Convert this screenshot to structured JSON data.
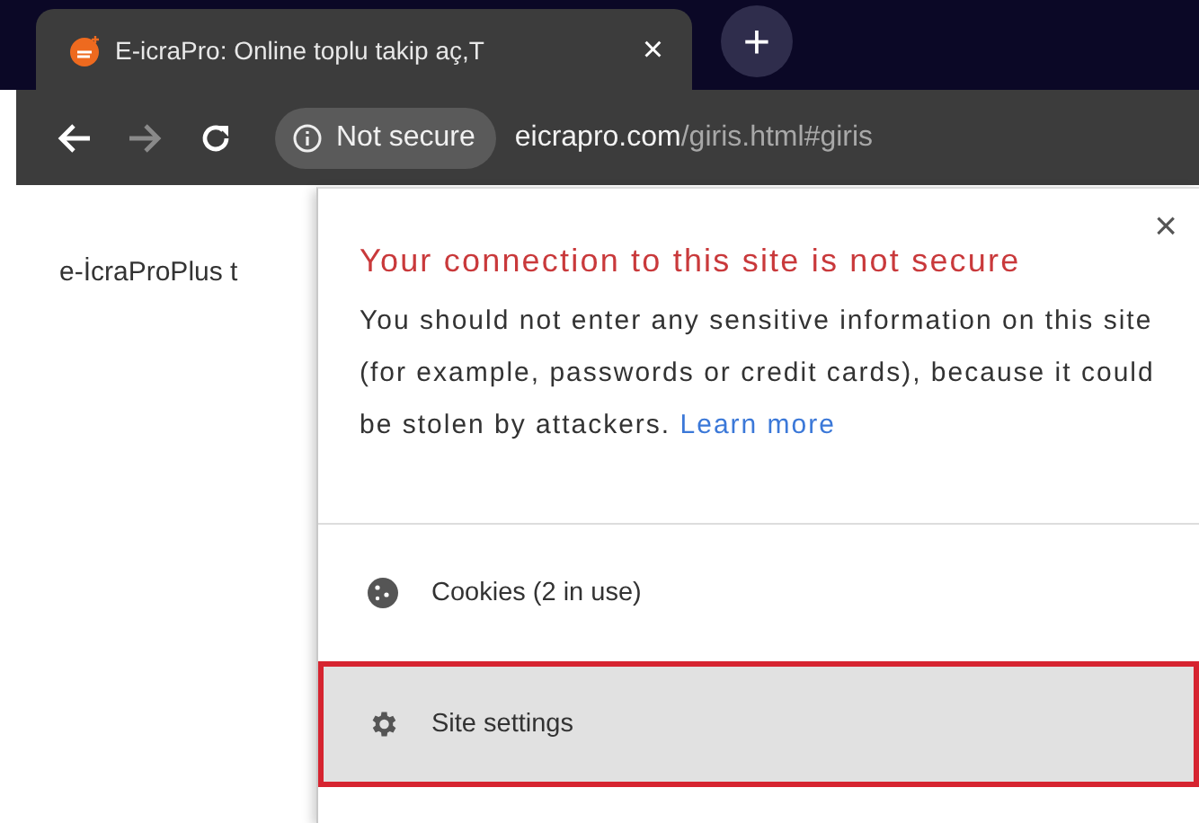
{
  "tab": {
    "title": "E-icraPro: Online toplu takip aç,T",
    "close": "×"
  },
  "new_tab": "+",
  "nav": [
    {
      "kind": "back",
      "disabled": false
    },
    {
      "kind": "forward",
      "disabled": true
    },
    {
      "kind": "reload",
      "disabled": false
    }
  ],
  "security_chip": {
    "label": "Not secure"
  },
  "address": {
    "host": "eicrapro.com",
    "path": "/giris.html#giris"
  },
  "page": {
    "text": "e-İcraProPlus t"
  },
  "popup": {
    "close": "×",
    "title": "Your connection to this site is not secure",
    "message": "You should not enter any sensitive information on this site (for example, passwords or credit cards), because it could be stolen by attackers.",
    "link": "Learn more",
    "items": [
      {
        "kind": "cookies",
        "label": "Cookies (2 in use)",
        "selected": false
      },
      {
        "kind": "settings",
        "label": "Site settings",
        "selected": true
      }
    ]
  }
}
